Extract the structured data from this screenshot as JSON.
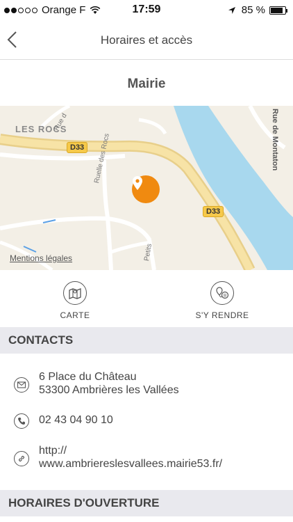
{
  "status_bar": {
    "carrier": "Orange F",
    "time": "17:59",
    "battery_percent": "85 %",
    "battery_level": 0.85,
    "signal_bars_filled": 2,
    "signal_bars_total": 5,
    "icons": [
      "wifi-icon",
      "location-arrow-icon",
      "battery-icon"
    ]
  },
  "nav": {
    "title": "Horaires et accès",
    "back_icon": "chevron-left-icon"
  },
  "page": {
    "title": "Mairie"
  },
  "map": {
    "place_label": "LES ROCS",
    "road_labels": [
      "D33",
      "D33"
    ],
    "street_ruelle": "Ruelle des Rocs",
    "street_montaton": "Rue de Montaton",
    "street_top": "Rue d",
    "street_petits": "Petits",
    "legal_link": "Mentions légales",
    "pin_icon": "location-pin-icon",
    "colors": {
      "land": "#f3efe6",
      "water": "#a8d8ee",
      "road": "#f6c94a",
      "pin": "#f08a10"
    }
  },
  "actions": {
    "map_label": "CARTE",
    "map_icon": "map-icon",
    "directions_label": "S'Y RENDRE",
    "directions_icon": "directions-icon"
  },
  "contacts": {
    "header": "CONTACTS",
    "address_line1": "6 Place du Château",
    "address_line2": "53300 Ambrières les Vallées",
    "address_icon": "envelope-icon",
    "phone": "02 43 04 90 10",
    "phone_icon": "phone-icon",
    "web_line1": "http://",
    "web_line2": "www.ambriereslesvallees.mairie53.fr/",
    "web_icon": "link-icon"
  },
  "hours": {
    "header": "HORAIRES D'OUVERTURE"
  }
}
